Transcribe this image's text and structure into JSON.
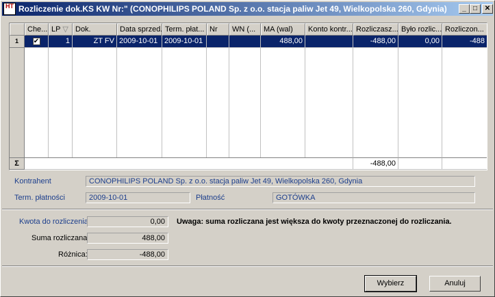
{
  "window": {
    "title": "Rozliczenie dok.KS KW Nr:\" (CONOPHILIPS POLAND Sp. z o.o. stacja paliw Jet 49, Wielkopolska 260, Gdynia)",
    "icon_text": "HT",
    "minimize": "_",
    "maximize": "□",
    "close": "✕"
  },
  "grid": {
    "columns": [
      "Che...",
      "LP",
      "Dok.",
      "Data sprzed..",
      "Term. płat...",
      "Nr",
      "WN (...",
      "MA (wal)",
      "Konto kontr...",
      "Rozliczasz...",
      "Było rozlic...",
      "Rozliczon..."
    ],
    "sort_glyph": "▽",
    "rows": [
      {
        "row_number": "1",
        "checked": "✔",
        "lp": "1",
        "dok": "ZT FV",
        "data_sprzed": "2009-10-01",
        "term_plat": "2009-10-01",
        "nr": "",
        "wn": "",
        "ma": "488,00",
        "konto": "",
        "rozliczasz": "-488,00",
        "bylo": "0,00",
        "rozliczon": "-488"
      }
    ],
    "footer": {
      "sigma": "Σ",
      "rozliczasz_total": "-488,00"
    }
  },
  "details": {
    "kontrahent_label": "Kontrahent",
    "kontrahent_value": "CONOPHILIPS POLAND Sp. z o.o. stacja paliw Jet 49, Wielkopolska 260, Gdynia",
    "term_label": "Term. płatności",
    "term_value": "2009-10-01",
    "platnosc_label": "Płatność",
    "platnosc_value": "GOTÓWKA"
  },
  "summary": {
    "kwota_label": "Kwota do rozliczenia:",
    "kwota_value": "0,00",
    "suma_label": "Suma rozliczana:",
    "suma_value": "488,00",
    "roznica_label": "Różnica:",
    "roznica_value": "-488,00",
    "warning": "Uwaga: suma rozliczana jest większa do kwoty przeznaczonej do rozliczania."
  },
  "buttons": {
    "wybierz": "Wybierz",
    "anuluj": "Anuluj"
  }
}
